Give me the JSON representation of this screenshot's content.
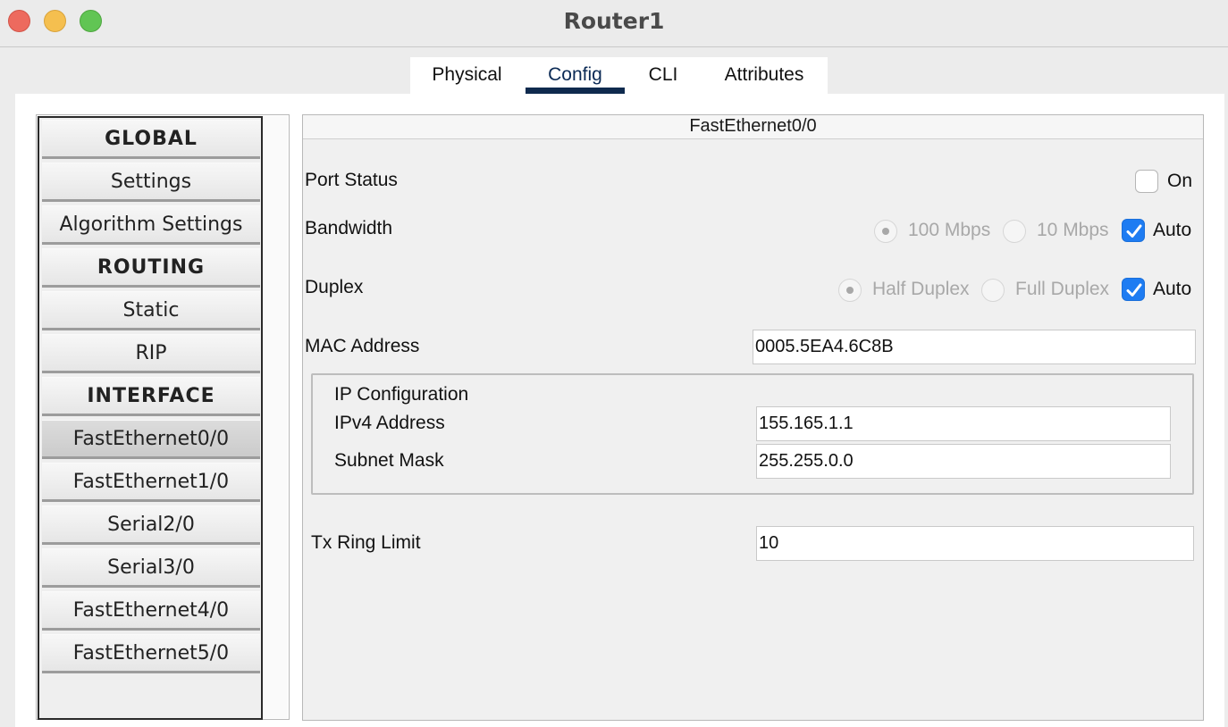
{
  "window": {
    "title": "Router1"
  },
  "tabs": [
    {
      "label": "Physical",
      "active": false
    },
    {
      "label": "Config",
      "active": true
    },
    {
      "label": "CLI",
      "active": false
    },
    {
      "label": "Attributes",
      "active": false
    }
  ],
  "sidebar": {
    "items": [
      {
        "label": "GLOBAL",
        "type": "header"
      },
      {
        "label": "Settings",
        "type": "item"
      },
      {
        "label": "Algorithm Settings",
        "type": "item"
      },
      {
        "label": "ROUTING",
        "type": "header"
      },
      {
        "label": "Static",
        "type": "item"
      },
      {
        "label": "RIP",
        "type": "item"
      },
      {
        "label": "INTERFACE",
        "type": "header"
      },
      {
        "label": "FastEthernet0/0",
        "type": "item",
        "selected": true
      },
      {
        "label": "FastEthernet1/0",
        "type": "item"
      },
      {
        "label": "Serial2/0",
        "type": "item"
      },
      {
        "label": "Serial3/0",
        "type": "item"
      },
      {
        "label": "FastEthernet4/0",
        "type": "item"
      },
      {
        "label": "FastEthernet5/0",
        "type": "item"
      }
    ]
  },
  "panel": {
    "title": "FastEthernet0/0",
    "port_status": {
      "label": "Port Status",
      "checkbox_label": "On",
      "checked": false
    },
    "bandwidth": {
      "label": "Bandwidth",
      "options": [
        "100 Mbps",
        "10 Mbps"
      ],
      "selected": "100 Mbps",
      "auto_label": "Auto",
      "auto_checked": true
    },
    "duplex": {
      "label": "Duplex",
      "options": [
        "Half Duplex",
        "Full Duplex"
      ],
      "selected": "Half Duplex",
      "auto_label": "Auto",
      "auto_checked": true
    },
    "mac": {
      "label": "MAC Address",
      "value": "0005.5EA4.6C8B"
    },
    "ip_config": {
      "title": "IP Configuration",
      "ipv4_label": "IPv4 Address",
      "ipv4_value": "155.165.1.1",
      "mask_label": "Subnet Mask",
      "mask_value": "255.255.0.0"
    },
    "tx_ring": {
      "label": "Tx Ring Limit",
      "value": "10"
    }
  },
  "colors": {
    "accent": "#1e7cf2",
    "tab_underline": "#0f2a4e"
  }
}
